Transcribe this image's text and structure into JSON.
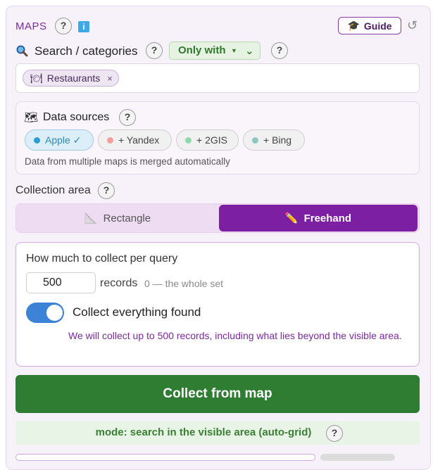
{
  "header": {
    "title": "MAPS",
    "guide_label": "Guide",
    "guide_icon": "🎓",
    "reset_icon": "↺",
    "info_glyph": "i"
  },
  "search": {
    "title": "Search / categories",
    "filter_label": "Only with",
    "tags": [
      {
        "icon": "🍽",
        "label": "Restaurants",
        "close": "×"
      }
    ]
  },
  "sources": {
    "title": "Data sources",
    "chips": [
      {
        "label": "Apple ✓",
        "active": true,
        "dot_color": "#2a9fd0"
      },
      {
        "label": "+ Yandex",
        "active": false,
        "dot_color": "#f4a098"
      },
      {
        "label": "+ 2GIS",
        "active": false,
        "dot_color": "#8fd8b0"
      },
      {
        "label": "+ Bing",
        "active": false,
        "dot_color": "#8fc8c0"
      }
    ],
    "note": "Data from multiple maps is merged automatically"
  },
  "area": {
    "title": "Collection area",
    "options": [
      {
        "label": "Rectangle",
        "icon": "📐",
        "selected": false
      },
      {
        "label": "Freehand",
        "icon": "✏️",
        "selected": true
      }
    ]
  },
  "collect": {
    "per_query_label": "How much to collect per query",
    "records_value": "500",
    "records_label": "records",
    "whole_set_hint": "0 — the whole set",
    "collect_all_label": "Collect everything found",
    "collect_all_on": true,
    "note": "We will collect up to 500 records, including what lies beyond the visible area."
  },
  "actions": {
    "collect_button": "Collect from map",
    "mode_text": "mode: search in the visible area (auto-grid)"
  },
  "colors": {
    "accent": "#7c1fa3",
    "primary_green": "#2e7d32",
    "toggle_blue": "#3c82d6"
  }
}
